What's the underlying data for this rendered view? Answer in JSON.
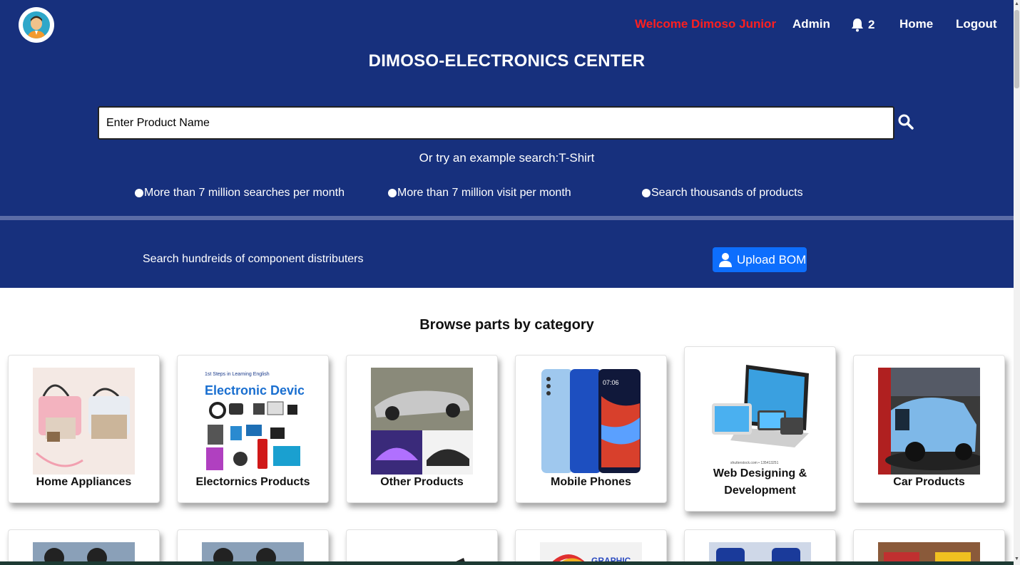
{
  "header": {
    "welcome": "Welcome Dimoso Junior",
    "admin": "Admin",
    "notification_count": "2",
    "home": "Home",
    "logout": "Logout",
    "title": "DIMOSO-ELECTRONICS CENTER"
  },
  "search": {
    "placeholder": "Enter Product Name",
    "example": "Or try an example search:T-Shirt"
  },
  "stats": [
    "More than 7 million searches per month",
    "More than 7 million visit per month",
    "Search thousands of products"
  ],
  "distributors": {
    "text": "Search hundreids of component distributers",
    "upload_label": "Upload BOM"
  },
  "browse": {
    "heading": "Browse parts by category"
  },
  "categories": [
    {
      "label": "Home Appliances"
    },
    {
      "label": "Electornics Products",
      "image_title": "Electronic Devices",
      "image_caption": "1st Steps in Learning English"
    },
    {
      "label": "Other Products"
    },
    {
      "label": "Mobile Phones",
      "image_time": "07:06"
    },
    {
      "label": "Web Designing & Development",
      "image_watermark": "shutterstock.com • 135413251"
    },
    {
      "label": "Car Products"
    }
  ],
  "second_row": [
    {
      "image_text": ""
    },
    {
      "image_text": ""
    },
    {
      "image_text": ""
    },
    {
      "image_text": "GRAPHIC"
    },
    {
      "image_text": ""
    },
    {
      "image_text": ""
    }
  ],
  "colors": {
    "hero": "#17307d",
    "welcome": "#ff1f1f",
    "upload_button": "#0d6efd"
  }
}
